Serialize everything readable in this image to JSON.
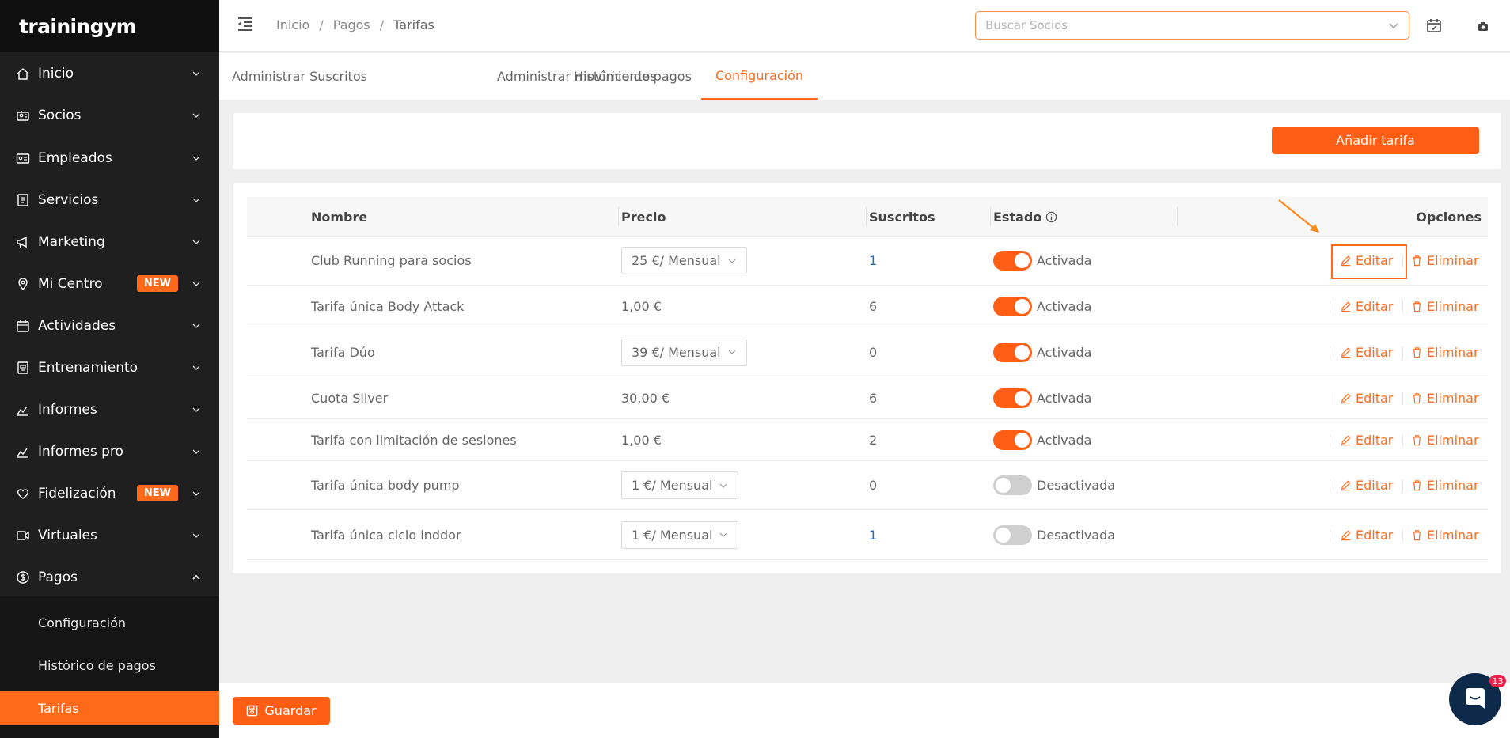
{
  "brand": {
    "logo_text": "trainingym"
  },
  "sidebar": {
    "items": [
      {
        "label": "Inicio",
        "icon": "home-icon"
      },
      {
        "label": "Socios",
        "icon": "members-icon"
      },
      {
        "label": "Empleados",
        "icon": "id-card-icon"
      },
      {
        "label": "Servicios",
        "icon": "services-icon"
      },
      {
        "label": "Marketing",
        "icon": "megaphone-icon"
      },
      {
        "label": "Mi Centro",
        "icon": "location-pin-icon",
        "badge": "NEW"
      },
      {
        "label": "Actividades",
        "icon": "calendar-icon"
      },
      {
        "label": "Entrenamiento",
        "icon": "training-icon"
      },
      {
        "label": "Informes",
        "icon": "chart-line-icon"
      },
      {
        "label": "Informes pro",
        "icon": "chart-line-icon"
      },
      {
        "label": "Fidelización",
        "icon": "heart-icon",
        "badge": "NEW"
      },
      {
        "label": "Virtuales",
        "icon": "video-icon"
      },
      {
        "label": "Pagos",
        "icon": "dollar-icon",
        "expanded": true
      }
    ],
    "subitems": [
      {
        "label": "Configuración",
        "active": false
      },
      {
        "label": "Histórico de pagos",
        "active": false
      },
      {
        "label": "Tarifas",
        "active": true
      }
    ]
  },
  "header": {
    "breadcrumb": [
      "Inicio",
      "Pagos",
      "Tarifas"
    ],
    "breadcrumb_sep": "/",
    "search_placeholder": "Buscar Socios"
  },
  "tabs": [
    {
      "label": "Administrar Suscritos",
      "active": false
    },
    {
      "label": "Administrar movimientos",
      "active": false
    },
    {
      "label": "Histórico de pagos",
      "active": false
    },
    {
      "label": "Configuración",
      "active": true
    }
  ],
  "toolbar": {
    "add_label": "Añadir tarifa"
  },
  "table": {
    "headers": {
      "name": "Nombre",
      "price": "Precio",
      "subscribed": "Suscritos",
      "status": "Estado",
      "options": "Opciones"
    },
    "edit_label": "Editar",
    "delete_label": "Eliminar",
    "rows": [
      {
        "name": "Club Running para socios",
        "price": "25 €/ Mensual",
        "price_select": true,
        "subscribed": "1",
        "subscribed_link": true,
        "status": "Activada",
        "on": true
      },
      {
        "name": "Tarifa única Body Attack",
        "price": "1,00 €",
        "price_select": false,
        "subscribed": "6",
        "subscribed_link": false,
        "status": "Activada",
        "on": true
      },
      {
        "name": "Tarifa Dúo",
        "price": "39 €/ Mensual",
        "price_select": true,
        "subscribed": "0",
        "subscribed_link": false,
        "status": "Activada",
        "on": true
      },
      {
        "name": "Cuota Silver",
        "price": "30,00 €",
        "price_select": false,
        "subscribed": "6",
        "subscribed_link": false,
        "status": "Activada",
        "on": true
      },
      {
        "name": "Tarifa con limitación de sesiones",
        "price": "1,00 €",
        "price_select": false,
        "subscribed": "2",
        "subscribed_link": false,
        "status": "Activada",
        "on": true
      },
      {
        "name": "Tarifa única body pump",
        "price": "1 €/ Mensual",
        "price_select": true,
        "subscribed": "0",
        "subscribed_link": false,
        "status": "Desactivada",
        "on": false
      },
      {
        "name": "Tarifa única ciclo inddor",
        "price": "1 €/ Mensual",
        "price_select": true,
        "subscribed": "1",
        "subscribed_link": true,
        "status": "Desactivada",
        "on": false
      }
    ]
  },
  "footer": {
    "save_label": "Guardar"
  },
  "chat": {
    "unread_count": "13"
  },
  "colors": {
    "accent": "#ff5e14",
    "sidebar_bg": "#1f1f1f",
    "link": "#2b6cb0"
  }
}
